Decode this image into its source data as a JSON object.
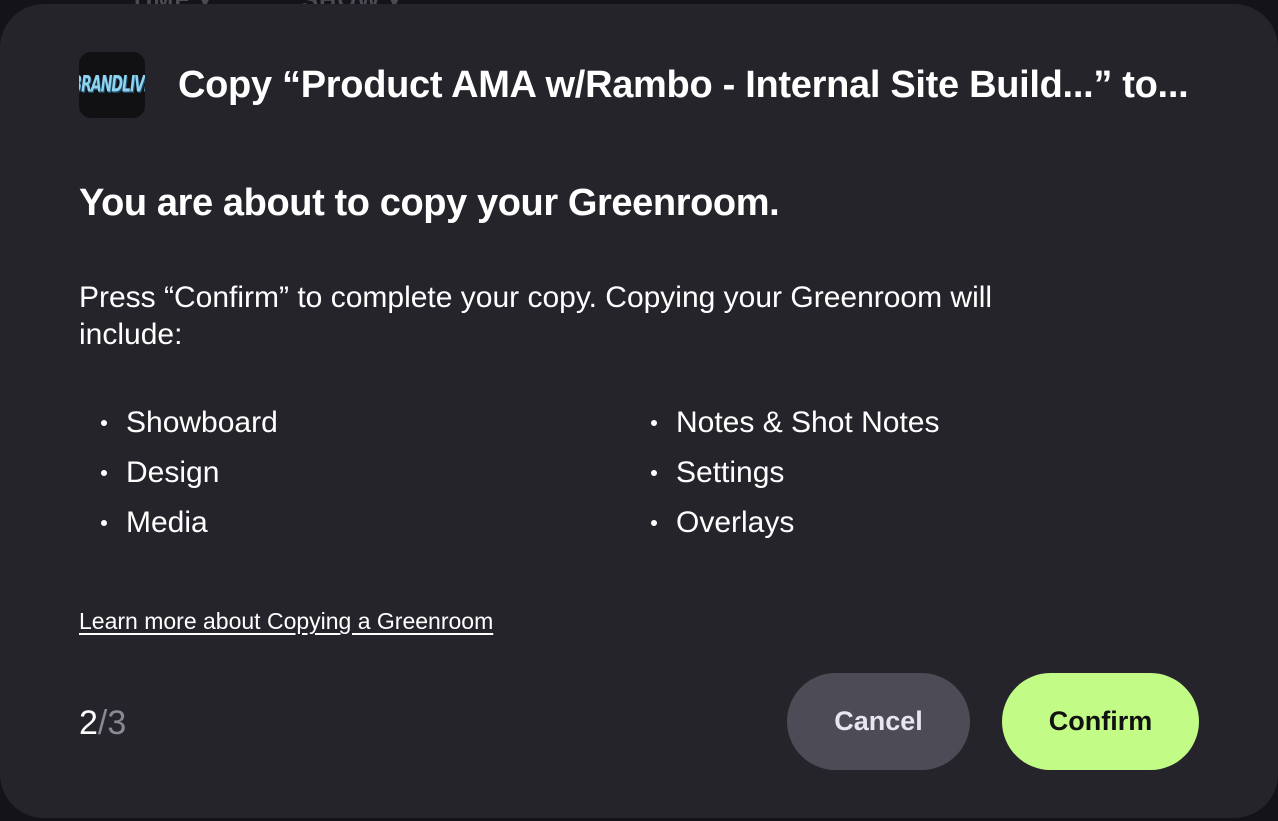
{
  "backdrop": {
    "items": [
      "TIME ▾",
      "SHOW ▾"
    ]
  },
  "modal": {
    "logo_text": "BRANDLIVE",
    "title": "Copy “Product AMA w/Rambo - Internal Site Build...” to...",
    "heading": "You are about to copy your Greenroom.",
    "description": "Press “Confirm” to complete your copy. Copying your Greenroom will include:",
    "includes": [
      "Showboard",
      "Design",
      "Media",
      "Notes & Shot Notes",
      "Settings",
      "Overlays"
    ],
    "learn_more_link": "Learn more about Copying a Greenroom",
    "pager": {
      "current": "2",
      "separator": "/",
      "total": "3"
    },
    "buttons": {
      "cancel": "Cancel",
      "confirm": "Confirm"
    }
  },
  "colors": {
    "modal_bg": "#26242b",
    "confirm_bg": "#c2fb86",
    "cancel_bg": "#4d4b55",
    "logo_accent": "#8fd3f0"
  }
}
